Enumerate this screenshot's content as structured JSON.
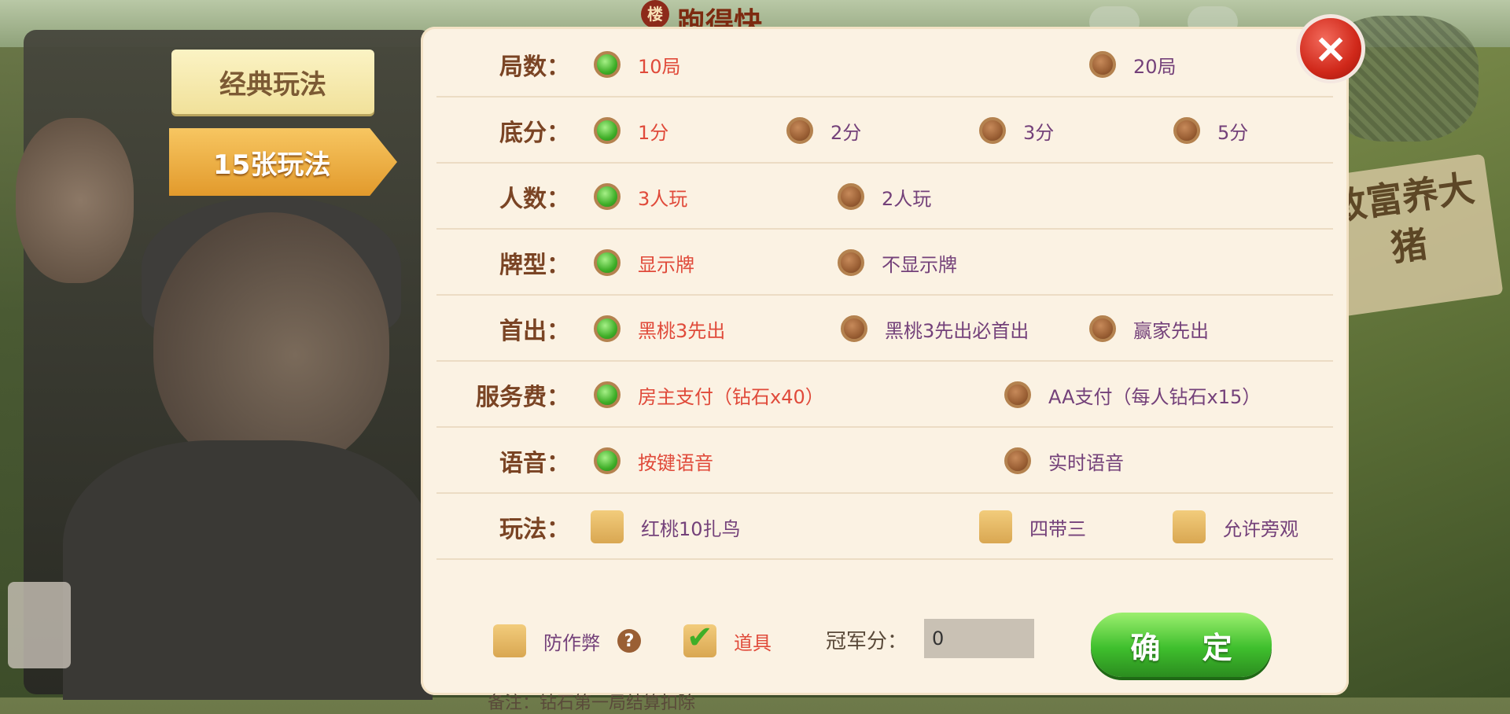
{
  "header": {
    "title_partial": "跑得快",
    "badge": "楼"
  },
  "tabs": [
    {
      "label": "经典玩法",
      "selected": false
    },
    {
      "label": "15张玩法",
      "selected": true
    }
  ],
  "close_icon": "×",
  "rows": [
    {
      "label": "局数：",
      "options": [
        {
          "text": "10局",
          "checked": true
        },
        {
          "text": "20局",
          "checked": false
        }
      ]
    },
    {
      "label": "底分：",
      "options": [
        {
          "text": "1分",
          "checked": true
        },
        {
          "text": "2分",
          "checked": false
        },
        {
          "text": "3分",
          "checked": false
        },
        {
          "text": "5分",
          "checked": false
        }
      ]
    },
    {
      "label": "人数：",
      "options": [
        {
          "text": "3人玩",
          "checked": true
        },
        {
          "text": "2人玩",
          "checked": false
        }
      ]
    },
    {
      "label": "牌型：",
      "options": [
        {
          "text": "显示牌",
          "checked": true
        },
        {
          "text": "不显示牌",
          "checked": false
        }
      ]
    },
    {
      "label": "首出：",
      "options": [
        {
          "text": "黑桃3先出",
          "checked": true
        },
        {
          "text": "黑桃3先出必首出",
          "checked": false
        },
        {
          "text": "赢家先出",
          "checked": false
        }
      ]
    },
    {
      "label": "服务费：",
      "options": [
        {
          "text": "房主支付（钻石x40）",
          "checked": true
        },
        {
          "text": "AA支付（每人钻石x15）",
          "checked": false
        }
      ]
    },
    {
      "label": "语音：",
      "options": [
        {
          "text": "按键语音",
          "checked": true
        },
        {
          "text": "实时语音",
          "checked": false
        }
      ]
    },
    {
      "label": "玩法：",
      "options": [
        {
          "text": "红桃10扎鸟",
          "checked": false
        },
        {
          "text": "四带三",
          "checked": false
        },
        {
          "text": "允许旁观",
          "checked": false
        }
      ]
    }
  ],
  "bottom": {
    "anti_cheat": {
      "text": "防作弊",
      "checked": false
    },
    "help_icon": "?",
    "props": {
      "text": "道具",
      "checked": true
    },
    "score_label": "冠军分：",
    "score_value": "0",
    "confirm": "确 定",
    "note": "备注：钻石第一局结算扣除"
  },
  "background": {
    "banner_text": "致富养大猪"
  },
  "colors": {
    "selected_text": "#e04a3a",
    "unselected_text": "#74417a",
    "label": "#7a4424",
    "radio_on": "#3fae28",
    "radio_off": "#9a5f34"
  }
}
